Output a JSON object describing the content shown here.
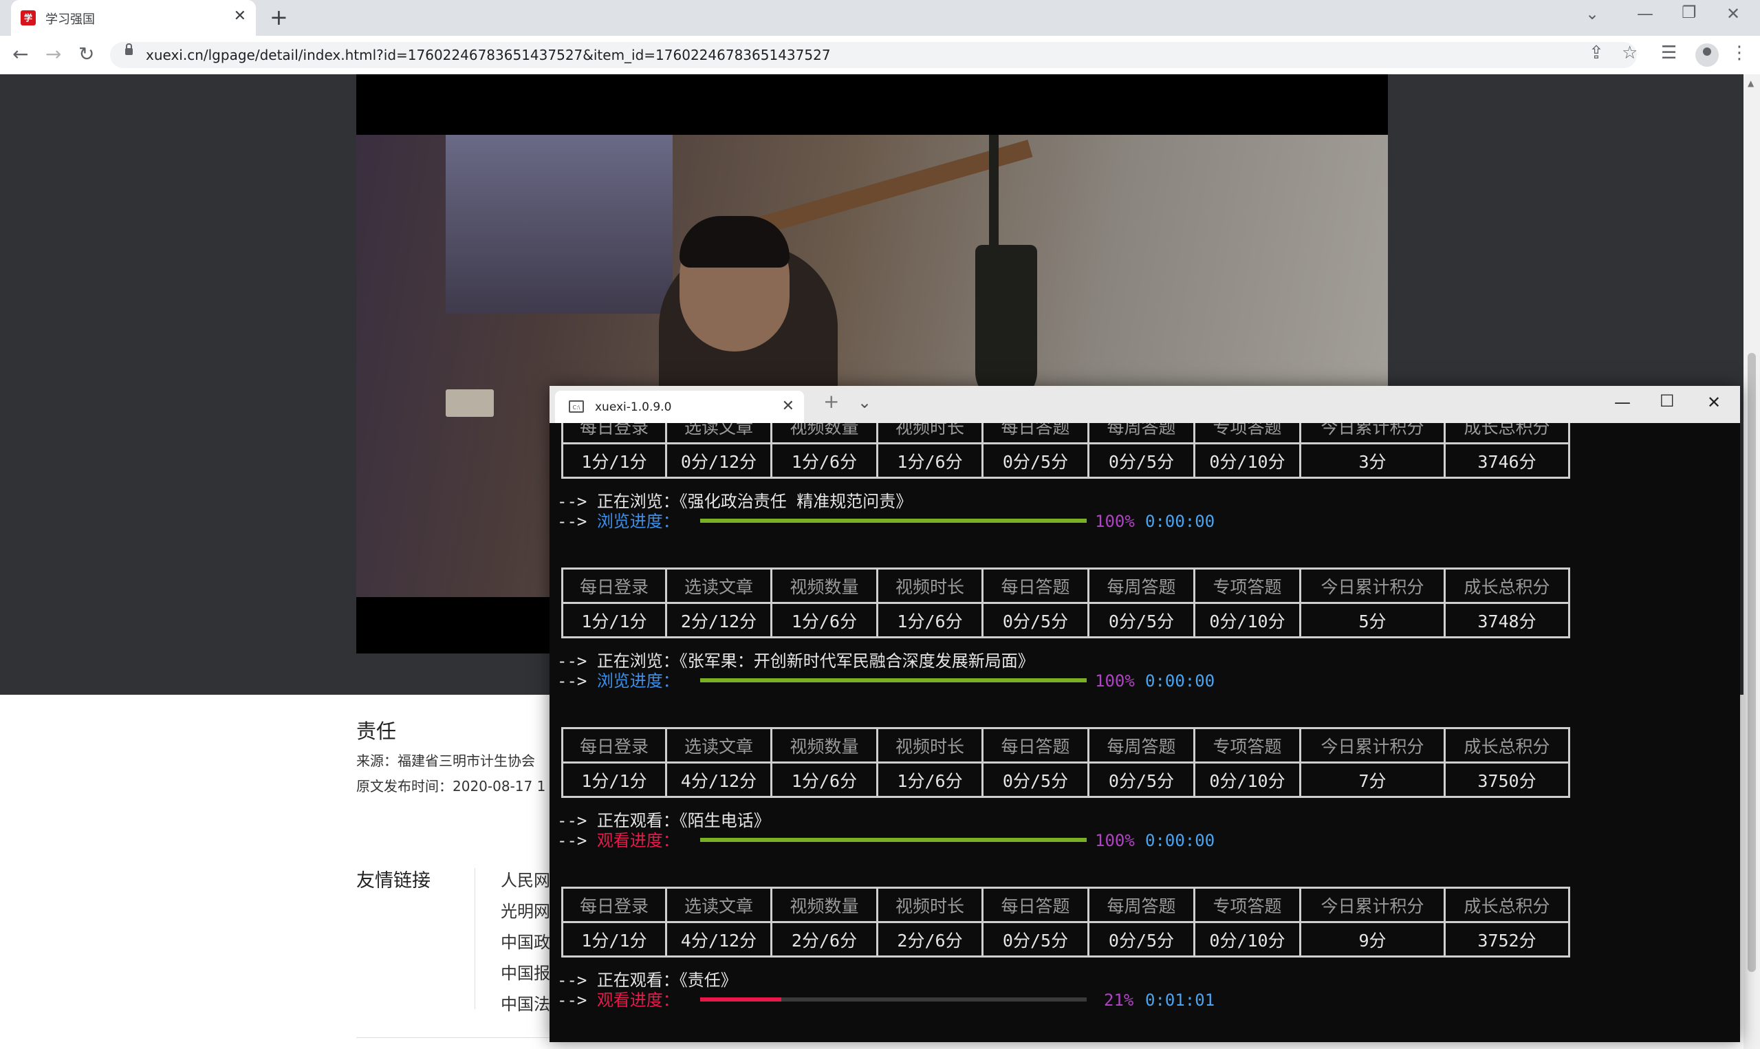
{
  "browser": {
    "tab_title": "学习强国",
    "tab_favicon_text": "学习",
    "url": "xuexi.cn/lgpage/detail/index.html?id=17602246783651437527&item_id=17602246783651437527"
  },
  "article": {
    "title": "责任",
    "source": "来源：福建省三明市计生协会",
    "publish_time": "原文发布时间：2020-08-17 1",
    "friend_links_heading": "友情链接",
    "friend_links": [
      "人民网",
      "光明网",
      "中国政",
      "中国报",
      "中国法"
    ]
  },
  "terminal": {
    "tab_title": "xuexi-1.0.9.0",
    "headers": [
      "每日登录",
      "选读文章",
      "视频数量",
      "视频时长",
      "每日答题",
      "每周答题",
      "专项答题",
      "今日累计积分",
      "成长总积分"
    ],
    "arrow": "-->",
    "blocks": [
      {
        "values": [
          "1分/1分",
          "0分/12分",
          "1分/6分",
          "1分/6分",
          "0分/5分",
          "0分/5分",
          "0分/10分",
          "3分",
          "3746分"
        ],
        "status": "正在浏览：《强化政治责任 精准规范问责》",
        "progress_label": "浏览进度：",
        "progress_percent": 100,
        "progress_text": "100%",
        "eta": "0:00:00",
        "color": "#7bb026",
        "label_color": "blue"
      },
      {
        "values": [
          "1分/1分",
          "2分/12分",
          "1分/6分",
          "1分/6分",
          "0分/5分",
          "0分/5分",
          "0分/10分",
          "5分",
          "3748分"
        ],
        "status": "正在浏览：《张军果：开创新时代军民融合深度发展新局面》",
        "progress_label": "浏览进度：",
        "progress_percent": 100,
        "progress_text": "100%",
        "eta": "0:00:00",
        "color": "#7bb026",
        "label_color": "blue"
      },
      {
        "values": [
          "1分/1分",
          "4分/12分",
          "1分/6分",
          "1分/6分",
          "0分/5分",
          "0分/5分",
          "0分/10分",
          "7分",
          "3750分"
        ],
        "status": "正在观看：《陌生电话》",
        "progress_label": "观看进度：",
        "progress_percent": 100,
        "progress_text": "100%",
        "eta": "0:00:00",
        "color": "#7bb026",
        "label_color": "red"
      },
      {
        "values": [
          "1分/1分",
          "4分/12分",
          "2分/6分",
          "2分/6分",
          "0分/5分",
          "0分/5分",
          "0分/10分",
          "9分",
          "3752分"
        ],
        "status": "正在观看：《责任》",
        "progress_label": "观看进度：",
        "progress_percent": 21,
        "progress_text": "21%",
        "eta": "0:01:01",
        "color": "#e8194a",
        "label_color": "red"
      }
    ]
  },
  "icons": [
    "back-icon",
    "forward-icon",
    "reload-icon",
    "lock-icon",
    "share-icon",
    "star-icon",
    "reading-list-icon",
    "profile-icon",
    "menu-icon",
    "terminal-icon"
  ]
}
